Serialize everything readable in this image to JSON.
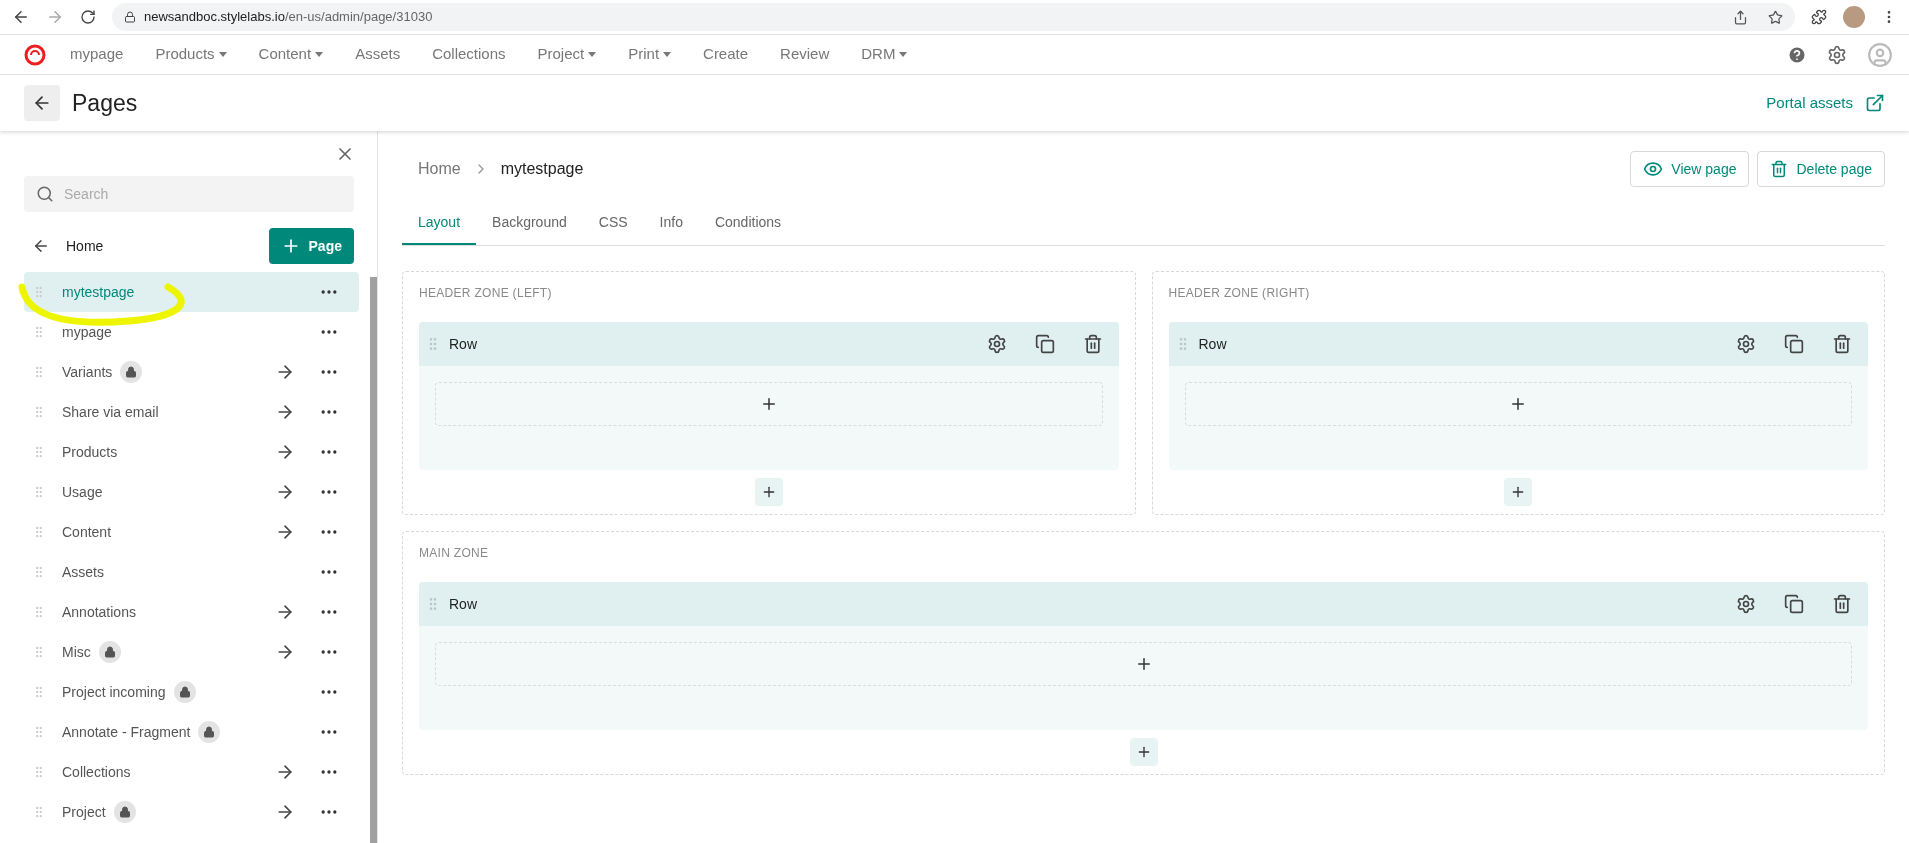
{
  "browser": {
    "url_host": "newsandboc.stylelabs.io",
    "url_path": "/en-us/admin/page/31030"
  },
  "nav": {
    "items": [
      {
        "label": "mypage",
        "dropdown": false
      },
      {
        "label": "Products",
        "dropdown": true
      },
      {
        "label": "Content",
        "dropdown": true
      },
      {
        "label": "Assets",
        "dropdown": false
      },
      {
        "label": "Collections",
        "dropdown": false
      },
      {
        "label": "Project",
        "dropdown": true
      },
      {
        "label": "Print",
        "dropdown": true
      },
      {
        "label": "Create",
        "dropdown": false
      },
      {
        "label": "Review",
        "dropdown": false
      },
      {
        "label": "DRM",
        "dropdown": true
      }
    ]
  },
  "header": {
    "title": "Pages",
    "link": "Portal assets"
  },
  "sidebar": {
    "search_placeholder": "Search",
    "parent": "Home",
    "add_button": "Page",
    "items": [
      {
        "label": "mytestpage",
        "selected": true,
        "locked": false,
        "navigable": false
      },
      {
        "label": "mypage",
        "selected": false,
        "locked": false,
        "navigable": false
      },
      {
        "label": "Variants",
        "selected": false,
        "locked": true,
        "navigable": true
      },
      {
        "label": "Share via email",
        "selected": false,
        "locked": false,
        "navigable": true
      },
      {
        "label": "Products",
        "selected": false,
        "locked": false,
        "navigable": true
      },
      {
        "label": "Usage",
        "selected": false,
        "locked": false,
        "navigable": true
      },
      {
        "label": "Content",
        "selected": false,
        "locked": false,
        "navigable": true
      },
      {
        "label": "Assets",
        "selected": false,
        "locked": false,
        "navigable": false
      },
      {
        "label": "Annotations",
        "selected": false,
        "locked": false,
        "navigable": true
      },
      {
        "label": "Misc",
        "selected": false,
        "locked": true,
        "navigable": true
      },
      {
        "label": "Project incoming",
        "selected": false,
        "locked": true,
        "navigable": false
      },
      {
        "label": "Annotate - Fragment",
        "selected": false,
        "locked": true,
        "navigable": false
      },
      {
        "label": "Collections",
        "selected": false,
        "locked": false,
        "navigable": true
      },
      {
        "label": "Project",
        "selected": false,
        "locked": true,
        "navigable": true
      }
    ]
  },
  "main": {
    "breadcrumb": [
      "Home",
      "mytestpage"
    ],
    "buttons": [
      {
        "kind": "view",
        "label": "View page"
      },
      {
        "kind": "delete",
        "label": "Delete page"
      }
    ],
    "tabs": [
      {
        "label": "Layout",
        "selected": true
      },
      {
        "label": "Background",
        "selected": false
      },
      {
        "label": "CSS",
        "selected": false
      },
      {
        "label": "Info",
        "selected": false
      },
      {
        "label": "Conditions",
        "selected": false
      }
    ],
    "header_zones": [
      {
        "title": "HEADER ZONE (LEFT)",
        "rows": [
          {
            "label": "Row"
          }
        ]
      },
      {
        "title": "HEADER ZONE (RIGHT)",
        "rows": [
          {
            "label": "Row"
          }
        ]
      }
    ],
    "main_zone": {
      "title": "MAIN ZONE",
      "rows": [
        {
          "label": "Row"
        }
      ]
    }
  }
}
